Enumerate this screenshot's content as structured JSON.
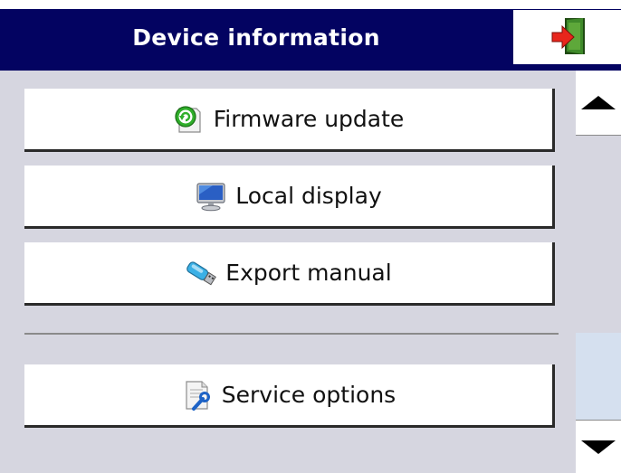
{
  "header": {
    "title": "Device information",
    "exit_icon": "exit-door-icon"
  },
  "menu": {
    "items": [
      {
        "label": "Firmware update",
        "icon": "firmware-update-icon"
      },
      {
        "label": "Local display",
        "icon": "monitor-icon"
      },
      {
        "label": "Export manual",
        "icon": "usb-stick-icon"
      },
      {
        "label": "Service options",
        "icon": "service-wrench-icon"
      }
    ]
  },
  "scrollbar": {
    "up_icon": "arrow-up-icon",
    "down_icon": "arrow-down-icon"
  },
  "colors": {
    "header_bg": "#030361",
    "screen_bg": "#d6d6e0",
    "thumb": "#d5e0ef",
    "exit_red": "#e8261c",
    "exit_door": "#3f8a2a"
  }
}
